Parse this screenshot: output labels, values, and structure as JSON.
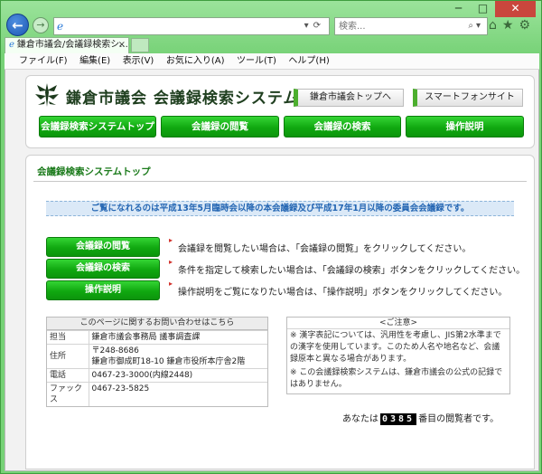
{
  "browser": {
    "search_placeholder": "検索...",
    "tab_title": "鎌倉市議会/会議録検索シ...",
    "menu": [
      "ファイル(F)",
      "編集(E)",
      "表示(V)",
      "お気に入り(A)",
      "ツール(T)",
      "ヘルプ(H)"
    ]
  },
  "header": {
    "site_title": "鎌倉市議会 会議録検索システム",
    "top_buttons": [
      "鎌倉市議会トップへ",
      "スマートフォンサイト"
    ],
    "nav": [
      "会議録検索システムトップ",
      "会議録の閲覧",
      "会議録の検索",
      "操作説明"
    ]
  },
  "main": {
    "page_title": "会議録検索システムトップ",
    "notice": "ご覧になれるのは平成13年5月臨時会以降の本会議録及び平成17年1月以降の委員会会議録です。",
    "actions": [
      {
        "label": "会議録の閲覧",
        "desc": "会議録を閲覧したい場合は、「会議録の閲覧」をクリックしてください。"
      },
      {
        "label": "会議録の検索",
        "desc": "条件を指定して検索したい場合は、「会議録の検索」ボタンをクリックしてください。"
      },
      {
        "label": "操作説明",
        "desc": "操作説明をご覧になりたい場合は、「操作説明」ボタンをクリックしてください。"
      }
    ],
    "contact": {
      "heading": "このページに関するお問い合わせはこちら",
      "rows": [
        {
          "label": "担当",
          "value": "鎌倉市議会事務局 議事調査課"
        },
        {
          "label": "住所",
          "value": "〒248-8686",
          "value2": "鎌倉市御成町18-10 鎌倉市役所本庁舎2階"
        },
        {
          "label": "電話",
          "value": "0467-23-3000(内線2448)"
        },
        {
          "label": "ファックス",
          "value": "0467-23-5825"
        }
      ]
    },
    "caution": {
      "heading": "<ご注意>",
      "p1": "※ 漢字表記については、汎用性を考慮し、JIS第2水準までの漢字を使用しています。このため人名や地名など、会議録原本と異なる場合があります。",
      "p2": "※ この会議録検索システムは、鎌倉市議会の公式の記録ではありません。"
    },
    "counter": {
      "prefix": "あなたは",
      "number": "0385",
      "suffix": "番目の閲覧者です。"
    }
  }
}
